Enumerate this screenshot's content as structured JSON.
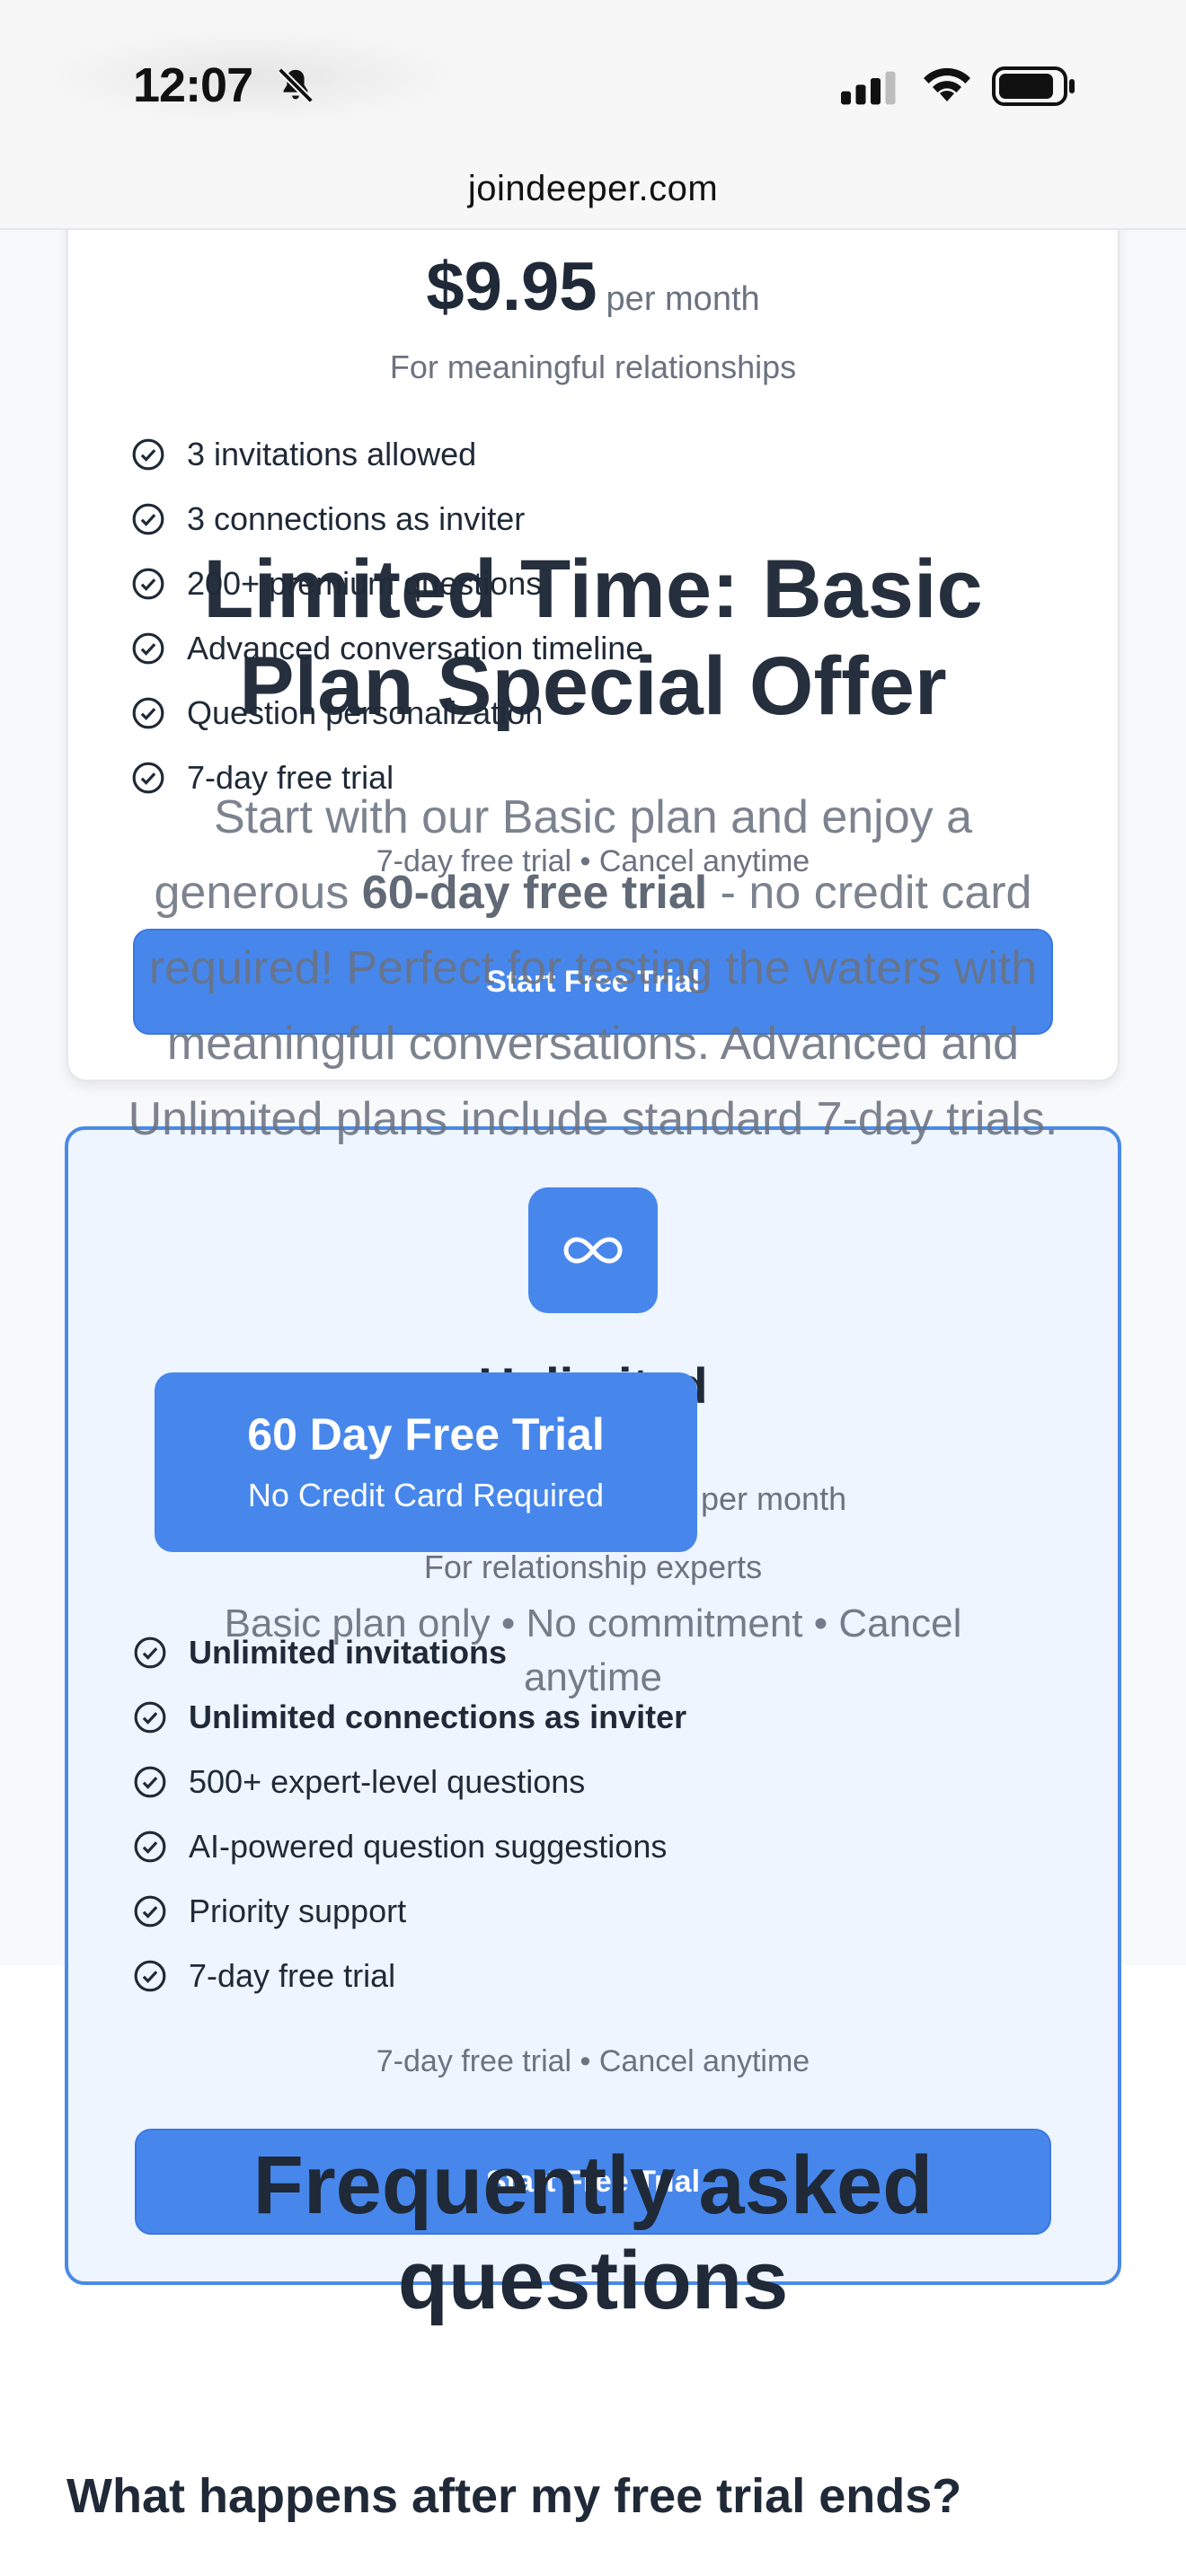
{
  "status_bar": {
    "time": "12:07",
    "url": "joindeeper.com"
  },
  "basic_plan": {
    "price": "$9.95",
    "period": "per month",
    "subtitle": "For meaningful relationships",
    "features": [
      "3 invitations allowed",
      "3 connections as inviter",
      "200+ premium questions",
      "Advanced conversation timeline",
      "Question personalization",
      "7-day free trial"
    ],
    "trial_note": "7-day free trial • Cancel anytime",
    "button_label": "Start Free Trial"
  },
  "unlimited_plan": {
    "name": "Unlimited",
    "period": "per month",
    "subtitle": "For relationship experts",
    "features": [
      "Unlimited invitations",
      "Unlimited connections as inviter",
      "500+ expert-level questions",
      "AI-powered question suggestions",
      "Priority support",
      "7-day free trial"
    ],
    "trial_note": "7-day free trial • Cancel anytime",
    "button_label": "Start Free Trial"
  },
  "offer_overlay": {
    "title_line1": "Limited Time: Basic",
    "title_line2": "Plan Special Offer",
    "desc_before": "Start with our Basic plan and enjoy a generous ",
    "desc_bold": "60-day free trial",
    "desc_after": " - no credit card required! Perfect for testing the waters with meaningful conversations. Advanced and Unlimited plans include standard 7-day trials.",
    "badge_title": "60 Day Free Trial",
    "badge_subtitle": "No Credit Card Required",
    "footnote": "Basic plan only • No commitment • Cancel anytime"
  },
  "faq": {
    "title_line1": "Frequently asked",
    "title_line2": "questions",
    "first_question": "What happens after my free trial ends?"
  },
  "colors": {
    "accent": "#4787ec",
    "unlimited_border": "#4a8ae6",
    "unlimited_bg": "#eef5ff"
  }
}
